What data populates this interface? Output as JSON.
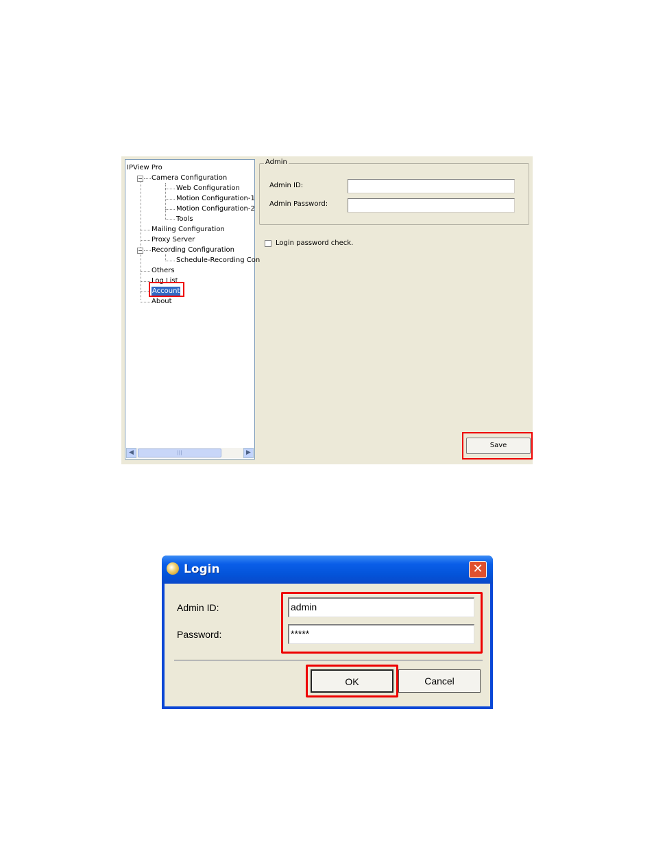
{
  "config_window": {
    "tree": {
      "root": "IPView Pro",
      "camera_configuration": "Camera Configuration",
      "web_configuration": "Web Configuration",
      "motion_configuration_1": "Motion Configuration-1",
      "motion_configuration_2": "Motion Configuration-2",
      "tools": "Tools",
      "mailing_configuration": "Mailing Configuration",
      "proxy_server": "Proxy Server",
      "recording_configuration": "Recording Configuration",
      "schedule_recording": "Schedule-Recording Con",
      "others": "Others",
      "log_list": "Log List",
      "account": "Account",
      "about": "About"
    },
    "admin_group_title": "Admin",
    "admin_id_label": "Admin ID:",
    "admin_password_label": "Admin Password:",
    "admin_id_value": "",
    "admin_password_value": "",
    "login_check_label": "Login password check.",
    "save_label": "Save",
    "scrollbar_thumb_grip": "|||"
  },
  "login_dialog": {
    "title": "Login",
    "close_glyph": "✕",
    "admin_id_label": "Admin ID:",
    "password_label": "Password:",
    "admin_id_value": "admin",
    "password_value": "*****",
    "ok_label": "OK",
    "cancel_label": "Cancel"
  },
  "colors": {
    "highlight": "#e00000",
    "selection": "#316ac5",
    "xp_titlebar": "#0a5ee8",
    "dialog_face": "#ece9d8"
  }
}
